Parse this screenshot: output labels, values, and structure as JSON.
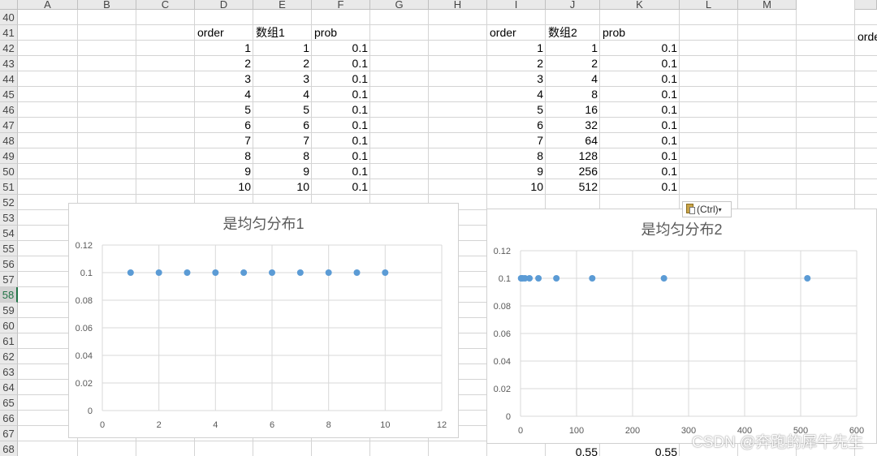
{
  "columns": [
    "A",
    "B",
    "C",
    "D",
    "E",
    "F",
    "G",
    "H",
    "I",
    "J",
    "K",
    "L",
    "M"
  ],
  "rows": [
    "40",
    "41",
    "42",
    "43",
    "44",
    "45",
    "46",
    "47",
    "48",
    "49",
    "50",
    "51",
    "52",
    "53",
    "54",
    "55",
    "56",
    "57",
    "58",
    "59",
    "60",
    "61",
    "62",
    "63",
    "64",
    "65",
    "66",
    "67",
    "68"
  ],
  "selected_row": "58",
  "table1": {
    "headers": [
      "order",
      "数组1",
      "prob"
    ],
    "rows": [
      [
        "1",
        "1",
        "0.1"
      ],
      [
        "2",
        "2",
        "0.1"
      ],
      [
        "3",
        "3",
        "0.1"
      ],
      [
        "4",
        "4",
        "0.1"
      ],
      [
        "5",
        "5",
        "0.1"
      ],
      [
        "6",
        "6",
        "0.1"
      ],
      [
        "7",
        "7",
        "0.1"
      ],
      [
        "8",
        "8",
        "0.1"
      ],
      [
        "9",
        "9",
        "0.1"
      ],
      [
        "10",
        "10",
        "0.1"
      ]
    ]
  },
  "table2": {
    "headers": [
      "order",
      "数组2",
      "prob"
    ],
    "rows": [
      [
        "1",
        "1",
        "0.1"
      ],
      [
        "2",
        "2",
        "0.1"
      ],
      [
        "3",
        "4",
        "0.1"
      ],
      [
        "4",
        "8",
        "0.1"
      ],
      [
        "5",
        "16",
        "0.1"
      ],
      [
        "6",
        "32",
        "0.1"
      ],
      [
        "7",
        "64",
        "0.1"
      ],
      [
        "8",
        "128",
        "0.1"
      ],
      [
        "9",
        "256",
        "0.1"
      ],
      [
        "10",
        "512",
        "0.1"
      ]
    ]
  },
  "right_edge_label": "orde",
  "row68": {
    "j_value": "0.55",
    "k_value": "0.55"
  },
  "paste_options_label": "(Ctrl)",
  "watermark": "CSDN @奔跑的犀牛先生",
  "colors": {
    "marker": "#5b9bd5",
    "gridline": "#d9d9d9",
    "axis_text": "#595959",
    "selected_row": "#217346"
  },
  "chart_data": [
    {
      "type": "scatter",
      "title": "是均匀分布1",
      "x": [
        1,
        2,
        3,
        4,
        5,
        6,
        7,
        8,
        9,
        10
      ],
      "y": [
        0.1,
        0.1,
        0.1,
        0.1,
        0.1,
        0.1,
        0.1,
        0.1,
        0.1,
        0.1
      ],
      "xlim": [
        0,
        12
      ],
      "ylim": [
        0,
        0.12
      ],
      "xticks": [
        "0",
        "2",
        "4",
        "6",
        "8",
        "10",
        "12"
      ],
      "yticks": [
        "0",
        "0.02",
        "0.04",
        "0.06",
        "0.08",
        "0.1",
        "0.12"
      ],
      "grid": true,
      "legend": "none"
    },
    {
      "type": "scatter",
      "title": "是均匀分布2",
      "x": [
        1,
        2,
        4,
        8,
        16,
        32,
        64,
        128,
        256,
        512
      ],
      "y": [
        0.1,
        0.1,
        0.1,
        0.1,
        0.1,
        0.1,
        0.1,
        0.1,
        0.1,
        0.1
      ],
      "xlim": [
        0,
        600
      ],
      "ylim": [
        0,
        0.12
      ],
      "xticks": [
        "0",
        "100",
        "200",
        "300",
        "400",
        "500",
        "600"
      ],
      "yticks": [
        "0",
        "0.02",
        "0.04",
        "0.06",
        "0.08",
        "0.1",
        "0.12"
      ],
      "grid": true,
      "legend": "none"
    }
  ]
}
